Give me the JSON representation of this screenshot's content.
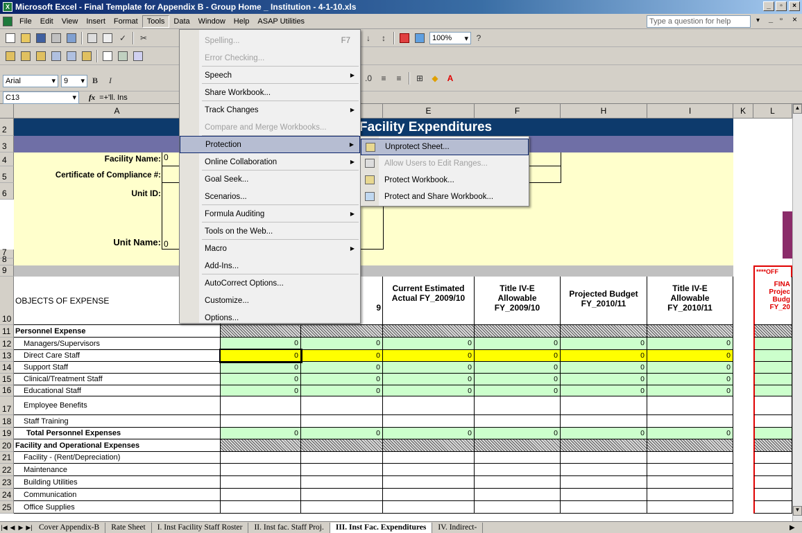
{
  "window": {
    "title": "Microsoft Excel - Final Template for Appendix B - Group Home _ Institution - 4-1-10.xls",
    "icon": "X"
  },
  "menubar": {
    "items": [
      "File",
      "Edit",
      "View",
      "Insert",
      "Format",
      "Tools",
      "Data",
      "Window",
      "Help",
      "ASAP Utilities"
    ],
    "help_placeholder": "Type a question for help"
  },
  "toolbar": {
    "zoom": "100%",
    "font": "Arial",
    "size": "9"
  },
  "formula_bar": {
    "cell_ref": "C13",
    "fx": "fx",
    "formula": "=+'ll. Ins"
  },
  "columns": [
    "A",
    "E",
    "F",
    "H",
    "I",
    "K",
    "L"
  ],
  "rows": [
    "2",
    "3",
    "4",
    "5",
    "6",
    "7",
    "8",
    "9",
    "10",
    "11",
    "12",
    "13",
    "14",
    "15",
    "16",
    "17",
    "18",
    "19",
    "20",
    "21",
    "22",
    "23",
    "24",
    "25"
  ],
  "sheet": {
    "title": "Facility Expenditures",
    "facility_name_label": "Facility Name:",
    "facility_name_value": "0",
    "certificate_label": "Certificate of Compliance #:",
    "unit_id_label": "Unit ID:",
    "unit_name_label": "Unit Name:",
    "unit_name_value": "0",
    "col_header_objects": "OBJECTS OF EXPENSE",
    "col_header_partial": "9",
    "col_e": "Current Estimated Actual FY_2009/10",
    "col_f": "Title IV-E Allowable FY_2009/10",
    "col_h": "Projected Budget FY_2010/11",
    "col_i": "Title IV-E Allowable FY_2010/11",
    "off_label": "****OFF",
    "col_l": "FINA Projec Budg FY_20",
    "labels": {
      "r11": "Personnel Expense",
      "r12": "Managers/Supervisors",
      "r13": "Direct Care Staff",
      "r14": "Support Staff",
      "r15": "Clinical/Treatment Staff",
      "r16": "Educational Staff",
      "r17": "Employee Benefits",
      "r18": "Staff Training",
      "r19": "Total Personnel Expenses",
      "r20": "Facility and Operational Expenses",
      "r21": "Facility - (Rent/Depreciation)",
      "r22": "Maintenance",
      "r23": "Building Utilities",
      "r24": "Communication",
      "r25": "Office Supplies"
    },
    "zero": "0"
  },
  "tools_menu": {
    "items": [
      {
        "label": "Spelling...",
        "shortcut": "F7",
        "disabled": true
      },
      {
        "label": "Error Checking...",
        "disabled": true
      },
      {
        "label": "Speech",
        "sub": true
      },
      {
        "label": "Share Workbook..."
      },
      {
        "label": "Track Changes",
        "sub": true
      },
      {
        "label": "Compare and Merge Workbooks...",
        "disabled": true
      },
      {
        "label": "Protection",
        "sub": true,
        "highlight": true
      },
      {
        "label": "Online Collaboration",
        "sub": true
      },
      {
        "label": "Goal Seek..."
      },
      {
        "label": "Scenarios..."
      },
      {
        "label": "Formula Auditing",
        "sub": true
      },
      {
        "label": "Tools on the Web..."
      },
      {
        "label": "Macro",
        "sub": true
      },
      {
        "label": "Add-Ins..."
      },
      {
        "label": "AutoCorrect Options..."
      },
      {
        "label": "Customize..."
      },
      {
        "label": "Options..."
      }
    ]
  },
  "protection_menu": {
    "items": [
      "Unprotect Sheet...",
      "Allow Users to Edit Ranges...",
      "Protect Workbook...",
      "Protect and Share Workbook..."
    ]
  },
  "tabs": [
    "Cover Appendix-B",
    "Rate Sheet",
    "I. Inst Facility Staff Roster",
    "II. Inst fac. Staff Proj.",
    "III. Inst Fac. Expenditures",
    "IV. Indirect-"
  ]
}
